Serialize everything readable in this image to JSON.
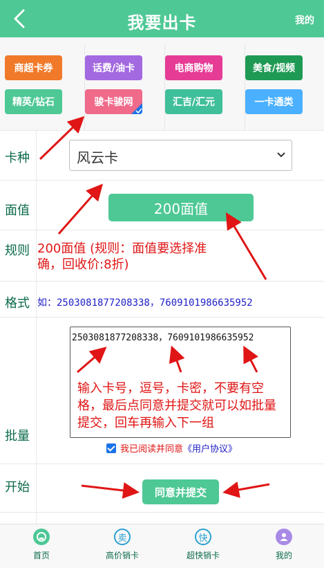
{
  "header": {
    "title": "我要出卡",
    "right_link": "我的"
  },
  "categories": [
    {
      "label": "商超卡券",
      "color": "#f07a2a"
    },
    {
      "label": "话费/油卡",
      "color": "#a369e0"
    },
    {
      "label": "电商购物",
      "color": "#e63c96"
    },
    {
      "label": "美食/视频",
      "color": "#1f9a55"
    },
    {
      "label": "精英/钻石",
      "color": "#4ec895"
    },
    {
      "label": "骏卡骏网",
      "color": "#f06a8a",
      "selected": true
    },
    {
      "label": "汇吉/汇元",
      "color": "#3fbf9a"
    },
    {
      "label": "一卡通类",
      "color": "#4ab0ff"
    }
  ],
  "form": {
    "card_type_label": "卡种",
    "card_type_value": "风云卡",
    "face_label": "面值",
    "face_value": "200面值",
    "rule_label": "规则",
    "rule_text": "200面值 (规则：面值要选择准确，回收价:8折)",
    "format_label": "格式",
    "format_text": "如：2503081877208338，7609101986635952",
    "batch_label": "批量",
    "batch_example": "2503081877208338，7609101986635952",
    "batch_tip": "输入卡号，逗号，卡密，不要有空格，最后点同意并提交就可以如批量提交，回车再输入下一组",
    "agree_text": "我已阅读并同意",
    "agree_link": "《用户协议》",
    "start_label": "开始",
    "submit_label": "同意并提交"
  },
  "tabbar": [
    {
      "label": "首页",
      "icon": "home-icon",
      "glyph": "⌂"
    },
    {
      "label": "高价销卡",
      "icon": "mai-icon",
      "glyph": "卖"
    },
    {
      "label": "超快销卡",
      "icon": "kuai-icon",
      "glyph": "快"
    },
    {
      "label": "我的",
      "icon": "user-icon",
      "glyph": "●"
    }
  ]
}
